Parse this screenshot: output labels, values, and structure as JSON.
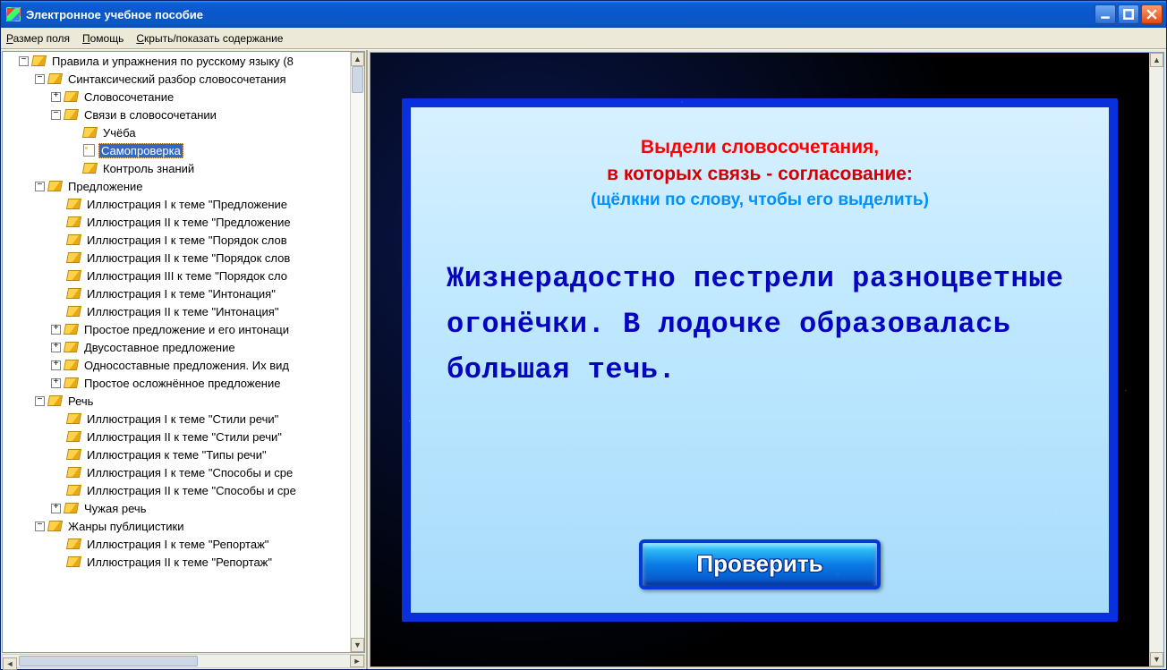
{
  "window": {
    "title": "Электронное учебное пособие"
  },
  "menu": {
    "fieldsize": "Размер поля",
    "help": "Помощь",
    "toggle_toc": "Скрыть/показать содержание"
  },
  "tree": {
    "root": "Правила и упражнения по русскому языку (8",
    "syntax": "Синтаксический разбор словосочетания",
    "phrase": "Словосочетание",
    "links": "Связи в словосочетании",
    "study": "Учёба",
    "selfcheck": "Самопроверка",
    "test": "Контроль знаний",
    "sentence": "Предложение",
    "ill_sentence_1": "Иллюстрация I к теме \"Предложение",
    "ill_sentence_2": "Иллюстрация II к теме \"Предложение",
    "ill_order_1": "Иллюстрация I к теме \"Порядок слов",
    "ill_order_2": "Иллюстрация II к теме \"Порядок слов",
    "ill_order_3": "Иллюстрация III к теме \"Порядок сло",
    "ill_inton_1": "Иллюстрация I к теме \"Интонация\"",
    "ill_inton_2": "Иллюстрация II к теме \"Интонация\"",
    "simple_sent": "Простое предложение и его интонаци",
    "two_part": "Двусоставное предложение",
    "one_part": "Односоставные предложения. Их вид",
    "simple_compl": "Простое осложнённое предложение",
    "speech": "Речь",
    "ill_style_1": "Иллюстрация I к теме \"Стили речи\"",
    "ill_style_2": "Иллюстрация II к теме \"Стили речи\"",
    "ill_types": "Иллюстрация к теме \"Типы речи\"",
    "ill_ways_1": "Иллюстрация I к теме \"Способы и сре",
    "ill_ways_2": "Иллюстрация II к теме \"Способы и сре",
    "foreign": "Чужая речь",
    "genres": "Жанры публицистики",
    "ill_report_1": "Иллюстрация I к теме \"Репортаж\"",
    "ill_report_2": "Иллюстрация II к теме \"Репортаж\""
  },
  "exercise": {
    "line1": "Выдели словосочетания,",
    "line2": "в которых связь - согласование:",
    "hint": "(щёлкни по слову, чтобы его выделить)",
    "sentence": "Жизнерадостно пестрели разноцветные огонёчки. В лодочке образовалась большая течь.",
    "check_btn": "Проверить"
  },
  "colors": {
    "titlebar": "#0a57c9",
    "accent_blue": "#0a2fdc",
    "exercise_red": "#ff0000",
    "exercise_text": "#0505c0"
  }
}
